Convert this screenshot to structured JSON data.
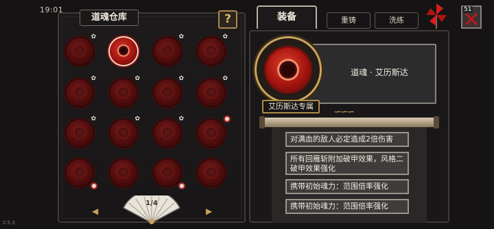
{
  "status": {
    "time": "19:01",
    "version": "2.5.3"
  },
  "storage": {
    "title": "道魂仓库",
    "help_label": "?",
    "page_indicator": "1/4",
    "slots": [
      {
        "selected": false,
        "star": true,
        "mark": false
      },
      {
        "selected": true,
        "star": false,
        "mark": false
      },
      {
        "selected": false,
        "star": true,
        "mark": false
      },
      {
        "selected": false,
        "star": true,
        "mark": false
      },
      {
        "selected": false,
        "star": true,
        "mark": false
      },
      {
        "selected": false,
        "star": true,
        "mark": false
      },
      {
        "selected": false,
        "star": true,
        "mark": false
      },
      {
        "selected": false,
        "star": true,
        "mark": false
      },
      {
        "selected": false,
        "star": true,
        "mark": false
      },
      {
        "selected": false,
        "star": true,
        "mark": false
      },
      {
        "selected": false,
        "star": true,
        "mark": false
      },
      {
        "selected": false,
        "star": false,
        "mark": true
      },
      {
        "selected": false,
        "star": false,
        "mark": true
      },
      {
        "selected": false,
        "star": false,
        "mark": false
      },
      {
        "selected": false,
        "star": false,
        "mark": true
      },
      {
        "selected": false,
        "star": false,
        "mark": false
      }
    ]
  },
  "tabs": {
    "equip": "装备",
    "recast": "重铸",
    "wash": "洗练"
  },
  "top_right": {
    "level": "51"
  },
  "detail": {
    "name": "道魂 · 艾历斯达",
    "exclusive_label": "艾历斯达专属",
    "effects": [
      "对满血的敌人必定造成2倍伤害",
      "所有回雁斩附加破甲效果，风格二破甲效果强化",
      "携带初始魂力：范围倍率强化",
      "携带初始魂力：范围倍率强化"
    ]
  },
  "colors": {
    "accent_gold": "#c9a25a",
    "spirit_red": "#a0140f",
    "panel_border": "#3d3a38"
  }
}
